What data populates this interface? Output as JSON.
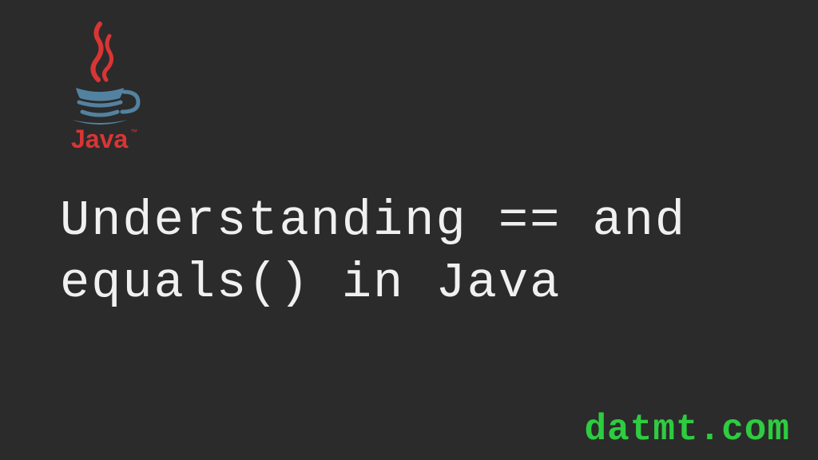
{
  "logo": {
    "name": "Java",
    "steamColor": "#d93535",
    "cupColor": "#5382a1",
    "textColor": "#d93535"
  },
  "heading": "Understanding == and\nequals() in Java",
  "website": "datmt.com"
}
